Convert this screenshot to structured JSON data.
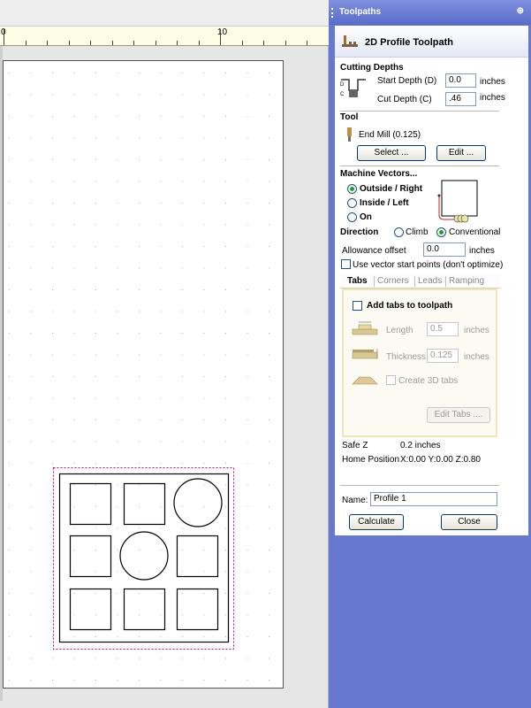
{
  "ruler": {
    "label_start": "0",
    "label_mid": "10"
  },
  "panel": {
    "title": "Toolpaths",
    "pin_glyph": "⊕",
    "header": {
      "title": "2D Profile Toolpath",
      "icon": "profile-toolpath-icon"
    },
    "cutting_depths": {
      "heading": "Cutting Depths",
      "start_label": "Start Depth (D)",
      "start_value": "0.0",
      "start_unit": "inches",
      "cut_label": "Cut Depth (C)",
      "cut_value": ".46",
      "cut_unit": "inches"
    },
    "tool": {
      "heading": "Tool",
      "name": "End Mill (0.125)",
      "select_label": "Select ...",
      "edit_label": "Edit ..."
    },
    "machine_vectors": {
      "heading": "Machine Vectors...",
      "options": [
        "Outside / Right",
        "Inside / Left",
        "On"
      ],
      "selected": "Outside / Right"
    },
    "direction": {
      "label": "Direction",
      "climb": "Climb",
      "conventional": "Conventional",
      "selected": "Conventional"
    },
    "allowance": {
      "label": "Allowance offset",
      "value": "0.0",
      "unit": "inches"
    },
    "vector_start": {
      "label": "Use vector start points (don't optimize)",
      "checked": false
    },
    "tabs": {
      "items": [
        "Tabs",
        "Corners",
        "Leads",
        "Ramping"
      ],
      "active": "Tabs",
      "add_tabs_label": "Add tabs to toolpath",
      "length_label": "Length",
      "length_value": "0.5",
      "length_unit": "inches",
      "thickness_label": "Thickness",
      "thickness_value": "0.125",
      "thickness_unit": "inches",
      "create3d_label": "Create 3D tabs",
      "edit_tabs_label": "Edit Tabs ...."
    },
    "safe_z": {
      "label": "Safe Z",
      "value": "0.2 inches"
    },
    "home_position": {
      "label": "Home Position",
      "value": "X:0.00 Y:0.00 Z:0.80"
    },
    "name": {
      "label": "Name:",
      "value": "Profile 1"
    },
    "calculate_label": "Calculate",
    "close_label": "Close"
  },
  "colors": {
    "panel_background": "#6678d0",
    "selection_boundary": "#cc0099",
    "ruler_background": "#fefee6"
  }
}
